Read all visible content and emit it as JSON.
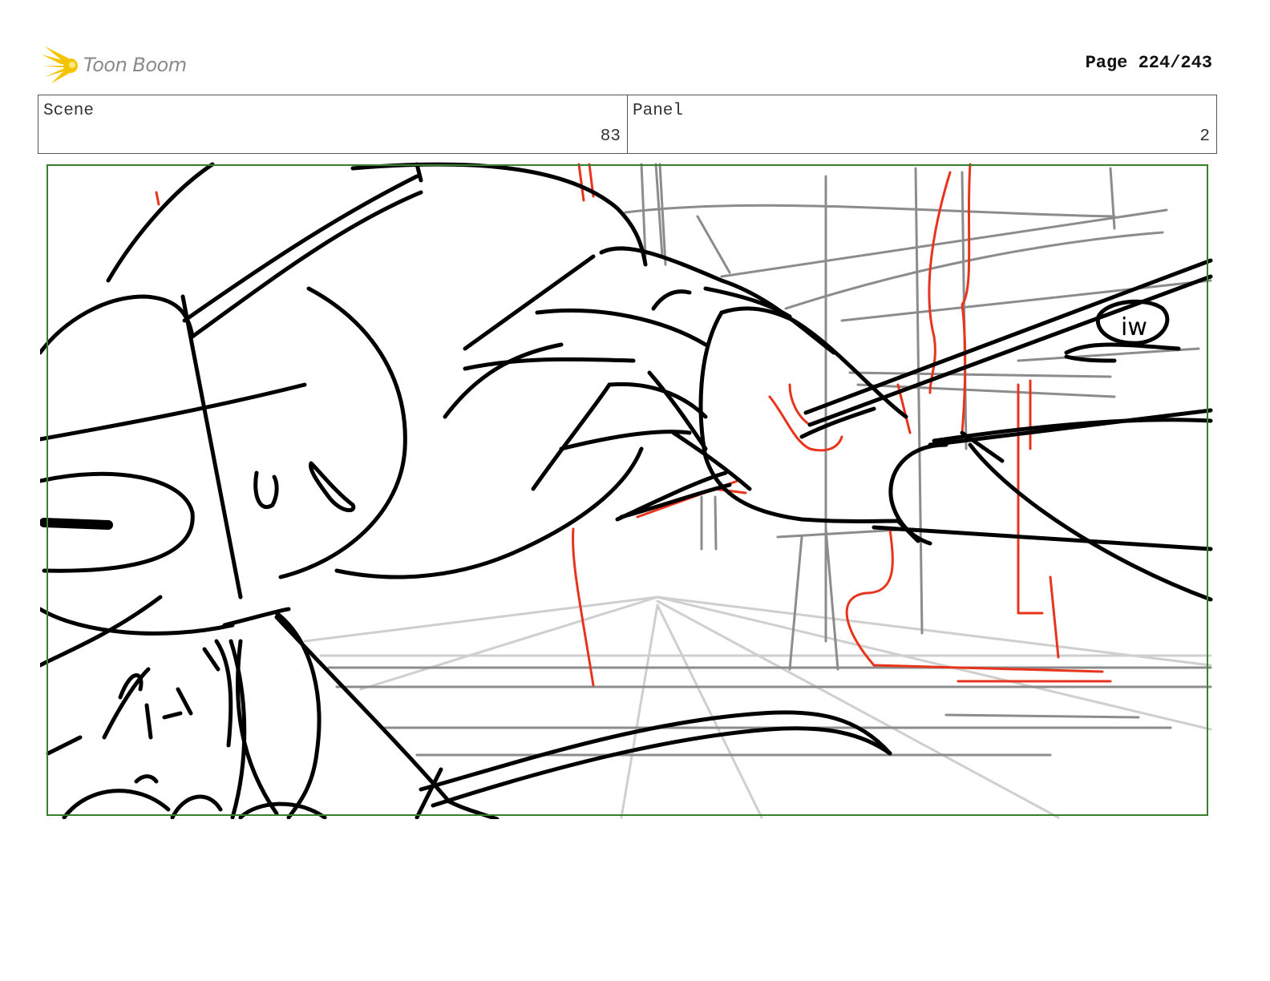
{
  "header": {
    "logo_text": "Toon Boom",
    "page_label": "Page 224/243"
  },
  "info": {
    "scene_label": "Scene",
    "scene_value": "83",
    "panel_label": "Panel",
    "panel_value": "2"
  },
  "sketch": {
    "annotation": "iw"
  },
  "colors": {
    "frame_border": "#3a7d2c",
    "ink": "#000000",
    "red_ink": "#e8341c",
    "grey_ink": "#8c8c8c",
    "light_grey_ink": "#c8c8c8",
    "logo_yellow": "#f5c400"
  }
}
